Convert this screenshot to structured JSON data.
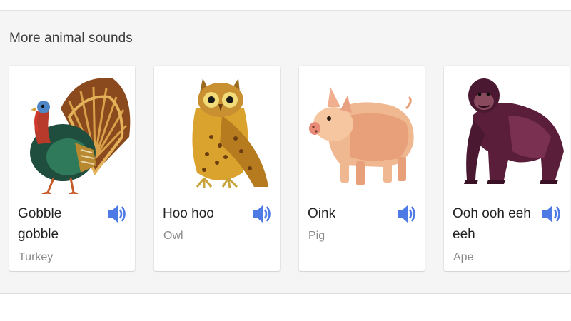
{
  "section": {
    "title": "More animal sounds"
  },
  "cards": [
    {
      "sound": "Gobble gobble",
      "name": "Turkey",
      "art_icon": "turkey-illustration",
      "speaker_icon": "speaker-icon"
    },
    {
      "sound": "Hoo hoo",
      "name": "Owl",
      "art_icon": "owl-illustration",
      "speaker_icon": "speaker-icon"
    },
    {
      "sound": "Oink",
      "name": "Pig",
      "art_icon": "pig-illustration",
      "speaker_icon": "speaker-icon"
    },
    {
      "sound": "Ooh ooh eeh eeh",
      "name": "Ape",
      "art_icon": "ape-illustration",
      "speaker_icon": "speaker-icon"
    }
  ],
  "colors": {
    "speaker": "#4e7ae6",
    "panel_bg": "#f5f5f5",
    "card_bg": "#ffffff"
  }
}
